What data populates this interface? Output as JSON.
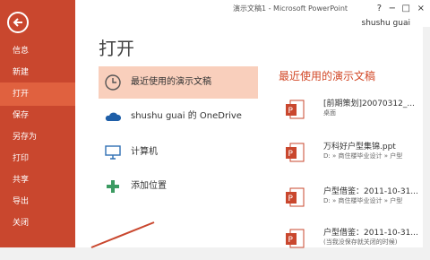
{
  "window": {
    "title": "演示文稿1 - Microsoft PowerPoint",
    "user": "shushu guai",
    "controls": [
      "?",
      "−",
      "□",
      "×"
    ]
  },
  "nav": {
    "back_icon": "back-arrow-icon",
    "items": [
      {
        "label": "信息",
        "active": false
      },
      {
        "label": "新建",
        "active": false
      },
      {
        "label": "打开",
        "active": true
      },
      {
        "label": "保存",
        "active": false
      },
      {
        "label": "另存为",
        "active": false
      },
      {
        "label": "打印",
        "active": false
      },
      {
        "label": "共享",
        "active": false
      },
      {
        "label": "导出",
        "active": false
      },
      {
        "label": "关闭",
        "active": false
      }
    ]
  },
  "main": {
    "title": "打开",
    "places": [
      {
        "label": "最近使用的演示文稿",
        "icon": "clock-icon",
        "selected": true
      },
      {
        "label": "shushu guai 的 OneDrive",
        "icon": "cloud-icon",
        "selected": false
      },
      {
        "label": "计算机",
        "icon": "computer-icon",
        "selected": false
      },
      {
        "label": "添加位置",
        "icon": "plus-icon",
        "selected": false
      }
    ]
  },
  "recent": {
    "title": "最近使用的演示文稿",
    "files": [
      {
        "name": "[前期策划]20070312_...",
        "path": "桌面"
      },
      {
        "name": "万科好户型集锦.ppt",
        "path": "D: » 商住楼毕业设计 » 户型"
      },
      {
        "name": "户型借鉴：2011-10-31...",
        "path": "D: » 商住楼毕业设计 » 户型"
      },
      {
        "name": "户型借鉴：2011-10-31...",
        "path": "(当我没保存就关闭的时候)"
      }
    ]
  },
  "colors": {
    "accent": "#c9472e",
    "nav_active": "#e0613f",
    "selection": "#f9cfbc",
    "recent_title": "#d24726"
  }
}
